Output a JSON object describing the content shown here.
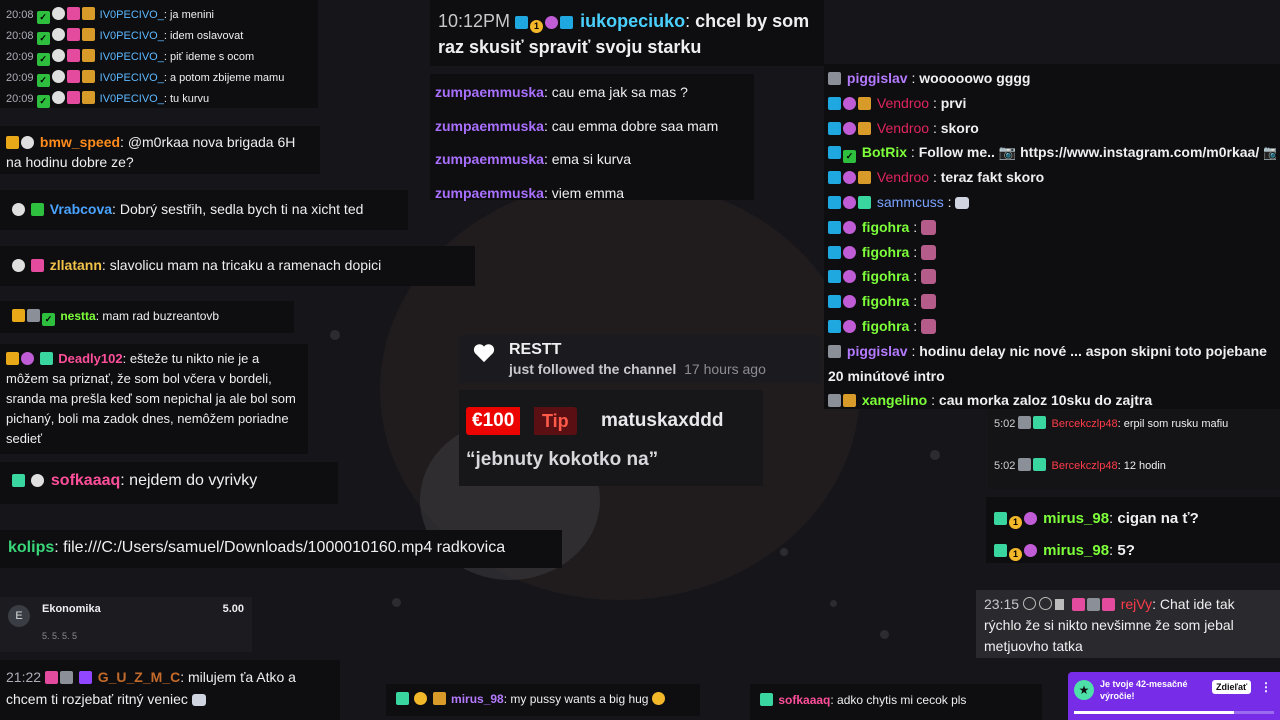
{
  "colors": {
    "panel_bg": "#0e0e10",
    "tip_red": "#eb0400",
    "notification_purple": "#772ce8"
  },
  "top_left_chat": [
    {
      "time": "20:08",
      "user": "IV0PECIVO_",
      "msg": "ja menini"
    },
    {
      "time": "20:08",
      "user": "IV0PECIVO_",
      "msg": "idem oslavovat"
    },
    {
      "time": "20:09",
      "user": "IV0PECIVO_",
      "msg": "piť ideme s ocom"
    },
    {
      "time": "20:09",
      "user": "IV0PECIVO_",
      "msg": "a potom zbijeme mamu"
    },
    {
      "time": "20:09",
      "user": "IV0PECIVO_",
      "msg": "tu kurvu"
    }
  ],
  "left_messages": {
    "bmw": {
      "user": "bmw_speed",
      "msg": "@m0rkaa nova brigada 6H na hodinu dobre ze?"
    },
    "vrabcova": {
      "user": "Vrabcova",
      "msg": "Dobrý sestřih, sedla bych ti na xicht ted"
    },
    "zllatann": {
      "user": "zllatann",
      "msg": "slavolicu mam na tricaku a ramenach dopici"
    },
    "nestta": {
      "user": "nestta",
      "msg": "mam rad buzreantovb"
    },
    "deadly": {
      "user": "Deadly102",
      "msg": "ešteže tu nikto nie je a môžem sa priznať, že som bol včera v bordeli, sranda ma prešla keď som nepichal ja ale bol som pichaný, boli ma zadok dnes, nemôžem poriadne sedieť"
    },
    "sofka": {
      "user": "sofkaaaq",
      "msg": "nejdem do vyrivky"
    },
    "kolips": {
      "user": "kolips",
      "msg": "file:///C:/Users/samuel/Downloads/1000010160.mp4 radkovica"
    }
  },
  "ekonomika": {
    "initial": "E",
    "title": "Ekonomika",
    "score": "5.00",
    "sub": "5. 5. 5. 5"
  },
  "guzmc": {
    "time": "21:22",
    "user": "G_U_Z_M_C",
    "msg": "milujem ťa Atko a chcem ti rozjebať ritný veniec"
  },
  "top_center": {
    "time": "10:12PM",
    "user": "iukopeciuko",
    "msg": "chcel by som raz skusiť spraviť svoju starku"
  },
  "zumpa_chat": [
    {
      "user": "zumpaemmuska",
      "msg": "cau ema jak sa mas ?"
    },
    {
      "user": "zumpaemmuska",
      "msg": "cau emma dobre saa mam"
    },
    {
      "user": "zumpaemmuska",
      "msg": "ema si kurva"
    },
    {
      "user": "zumpaemmuska",
      "msg": "viem emma"
    }
  ],
  "follow_alert": {
    "user": "RESTT",
    "text": "just followed the channel",
    "time": "17 hours ago"
  },
  "tip_alert": {
    "amount": "€100",
    "label": "Tip",
    "user": "matuskaxddd",
    "msg": "“jebnuty kokotko na”"
  },
  "bottom_center": {
    "user": "mirus_98",
    "msg": "my pussy wants a big hug"
  },
  "bottom_center2": {
    "user": "sofkaaaq",
    "msg": "adko chytis mi cecok pls"
  },
  "right_chat": [
    {
      "user": "piggislav",
      "msg": "wooooowo gggg",
      "color": "#b47aff"
    },
    {
      "user": "Vendroo",
      "msg": "prvi",
      "color": "#e0245e"
    },
    {
      "user": "Vendroo",
      "msg": "skoro",
      "color": "#e0245e"
    },
    {
      "user": "BotRix",
      "msg": "Follow me.. 📷 https://www.instagram.com/m0rkaa/ 📷",
      "color": "#7dff3a"
    },
    {
      "user": "Vendroo",
      "msg": "teraz fakt skoro",
      "color": "#e0245e"
    },
    {
      "user": "sammcuss",
      "msg": "",
      "color": "#7aa2ff"
    },
    {
      "user": "figohra",
      "msg": "",
      "color": "#7dff3a"
    },
    {
      "user": "figohra",
      "msg": "",
      "color": "#7dff3a"
    },
    {
      "user": "figohra",
      "msg": "",
      "color": "#7dff3a"
    },
    {
      "user": "figohra",
      "msg": "",
      "color": "#7dff3a"
    },
    {
      "user": "figohra",
      "msg": "",
      "color": "#7dff3a"
    },
    {
      "user": "piggislav",
      "msg": "hodinu delay nic nové ... aspon skipni toto pojebane 20 minútové intro",
      "color": "#b47aff"
    },
    {
      "user": "xangelino",
      "msg": "cau morka zaloz 10sku do zajtra",
      "color": "#7dff3a"
    }
  ],
  "bercek": [
    {
      "time": "5:02",
      "user": "Bercekczlp48",
      "msg": "erpil som rusku mafiu"
    },
    {
      "time": "5:02",
      "user": "Bercekczlp48",
      "msg": "12 hodin"
    }
  ],
  "mirus_right": [
    {
      "user": "mirus_98",
      "msg": "cigan na ť?"
    },
    {
      "user": "mirus_98",
      "msg": "5?"
    }
  ],
  "rejvy": {
    "time": "23:15",
    "user": "rejVy",
    "msg": "Chat ide tak rýchlo že si nikto nevšimne že som jebal metjuovho tatka"
  },
  "notification": {
    "text": "Je tvoje 42-mesačné výročie!",
    "button": "Zdieľať",
    "progress": 0.8
  }
}
